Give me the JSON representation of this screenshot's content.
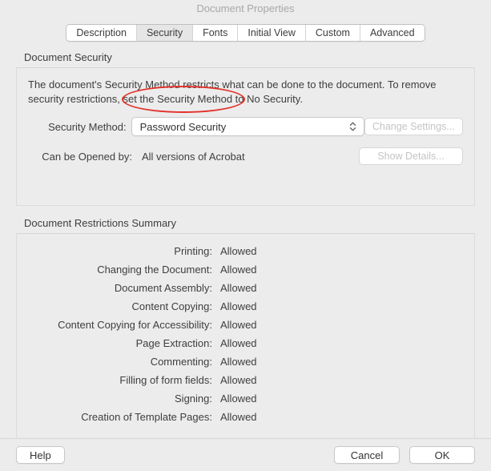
{
  "window": {
    "title": "Document Properties"
  },
  "tabs": {
    "description": "Description",
    "security": "Security",
    "fonts": "Fonts",
    "initial_view": "Initial View",
    "custom": "Custom",
    "advanced": "Advanced",
    "active": "security"
  },
  "security_section": {
    "heading": "Document Security",
    "description": "The document's Security Method restricts what can be done to the document. To remove security restrictions, set the Security Method to No Security.",
    "method_label": "Security Method:",
    "method_value": "Password Security",
    "change_settings": "Change Settings...",
    "opened_label": "Can be Opened by:",
    "opened_value": "All versions of Acrobat",
    "show_details": "Show Details..."
  },
  "restrictions": {
    "heading": "Document Restrictions Summary",
    "items": [
      {
        "label": "Printing:",
        "value": "Allowed"
      },
      {
        "label": "Changing the Document:",
        "value": "Allowed"
      },
      {
        "label": "Document Assembly:",
        "value": "Allowed"
      },
      {
        "label": "Content Copying:",
        "value": "Allowed"
      },
      {
        "label": "Content Copying for Accessibility:",
        "value": "Allowed"
      },
      {
        "label": "Page Extraction:",
        "value": "Allowed"
      },
      {
        "label": "Commenting:",
        "value": "Allowed"
      },
      {
        "label": "Filling of form fields:",
        "value": "Allowed"
      },
      {
        "label": "Signing:",
        "value": "Allowed"
      },
      {
        "label": "Creation of Template Pages:",
        "value": "Allowed"
      }
    ]
  },
  "footer": {
    "help": "Help",
    "cancel": "Cancel",
    "ok": "OK"
  },
  "annotation": {
    "highlight": "security-method-dropdown"
  }
}
